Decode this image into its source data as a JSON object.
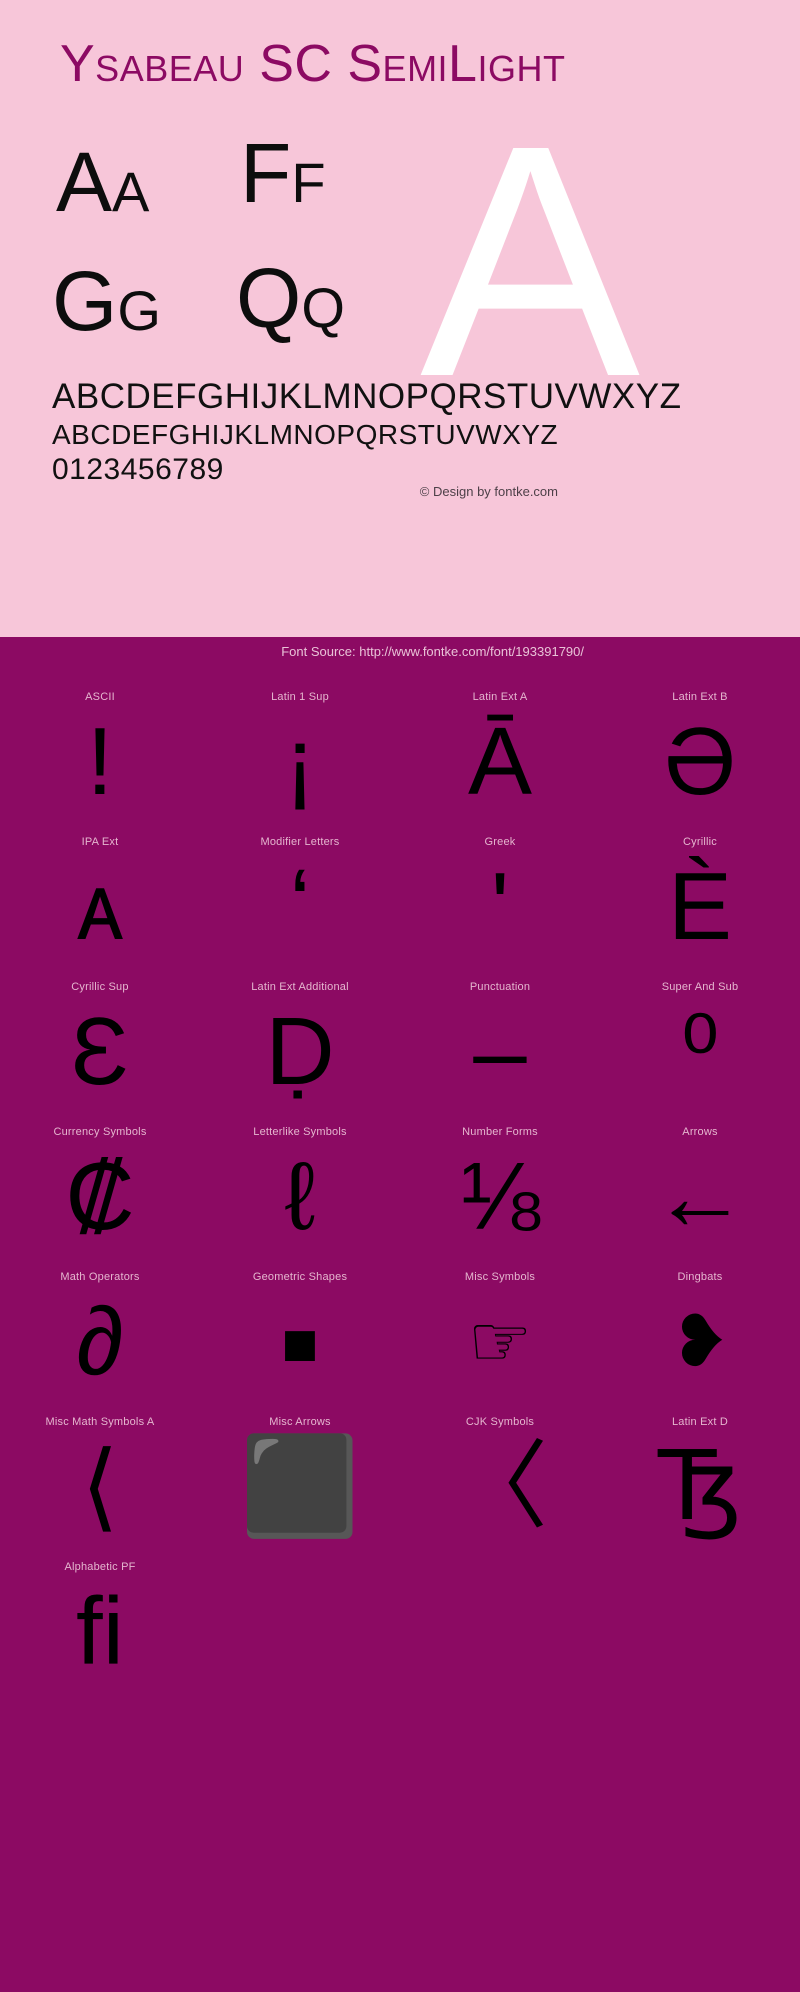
{
  "page": {
    "title": "Ysabeau SC SemiLight",
    "pink_bg": "#f7c6d9",
    "magenta_bg": "#8c0a63",
    "title_color": "#8c0a63",
    "watermark_letter": "A"
  },
  "samples": {
    "pairs": [
      {
        "upper": "A",
        "lower": "A"
      },
      {
        "upper": "F",
        "lower": "F"
      },
      {
        "upper": "G",
        "lower": "G"
      },
      {
        "upper": "Q",
        "lower": "Q"
      }
    ],
    "alphabet_upper": "ABCDEFGHIJKLMNOPQRSTUVWXYZ",
    "alphabet_smallcaps": "ABCDEFGHIJKLMNOPQRSTUVWXYZ",
    "digits": "0123456789"
  },
  "credits": {
    "copyright": "© Design by fontke.com",
    "source": "Font Source: http://www.fontke.com/font/193391790/"
  },
  "glyph_grid": {
    "rows": [
      [
        {
          "label": "ASCII",
          "glyph": "!",
          "size": "big"
        },
        {
          "label": "Latin 1 Sup",
          "glyph": "¡",
          "size": "big"
        },
        {
          "label": "Latin Ext A",
          "glyph": "Ā",
          "size": "big"
        },
        {
          "label": "Latin Ext B",
          "glyph": "Ə",
          "size": "big"
        }
      ],
      [
        {
          "label": "IPA Ext",
          "glyph": "ᴀ",
          "size": "big"
        },
        {
          "label": "Modifier Letters",
          "glyph": "ʻ",
          "size": "big"
        },
        {
          "label": "Greek",
          "glyph": "ʹ",
          "size": "big"
        },
        {
          "label": "Cyrillic",
          "glyph": "Ѐ",
          "size": "big"
        }
      ],
      [
        {
          "label": "Cyrillic Sup",
          "glyph": "Ɛ",
          "size": "big"
        },
        {
          "label": "Latin Ext Additional",
          "glyph": "Ḍ",
          "size": "big"
        },
        {
          "label": "Punctuation",
          "glyph": "‒",
          "size": "big"
        },
        {
          "label": "Super And Sub",
          "glyph": "⁰",
          "size": "big"
        }
      ],
      [
        {
          "label": "Currency Symbols",
          "glyph": "₡",
          "size": "big"
        },
        {
          "label": "Letterlike Symbols",
          "glyph": "ℓ",
          "size": "big"
        },
        {
          "label": "Number Forms",
          "glyph": "⅛",
          "size": "big"
        },
        {
          "label": "Arrows",
          "glyph": "←",
          "size": "big"
        }
      ],
      [
        {
          "label": "Math Operators",
          "glyph": "∂",
          "size": "big"
        },
        {
          "label": "Geometric Shapes",
          "glyph": "◼",
          "size": "square-sm"
        },
        {
          "label": "Misc Symbols",
          "glyph": "☞",
          "size": "dingbat"
        },
        {
          "label": "Dingbats",
          "glyph": "❥",
          "size": "dingbat"
        }
      ],
      [
        {
          "label": "Misc Math Symbols A",
          "glyph": "⟨",
          "size": "big"
        },
        {
          "label": "Misc Arrows",
          "glyph": "⬛",
          "size": "square-lg"
        },
        {
          "label": "CJK Symbols",
          "glyph": "〈",
          "size": "big"
        },
        {
          "label": "Latin Ext D",
          "glyph": "Ꜩ",
          "size": "big"
        }
      ],
      [
        {
          "label": "Alphabetic PF",
          "glyph": "ﬁ",
          "size": "big"
        },
        {
          "label": "",
          "glyph": "",
          "size": "big"
        },
        {
          "label": "",
          "glyph": "",
          "size": "big"
        },
        {
          "label": "",
          "glyph": "",
          "size": "big"
        }
      ]
    ]
  }
}
